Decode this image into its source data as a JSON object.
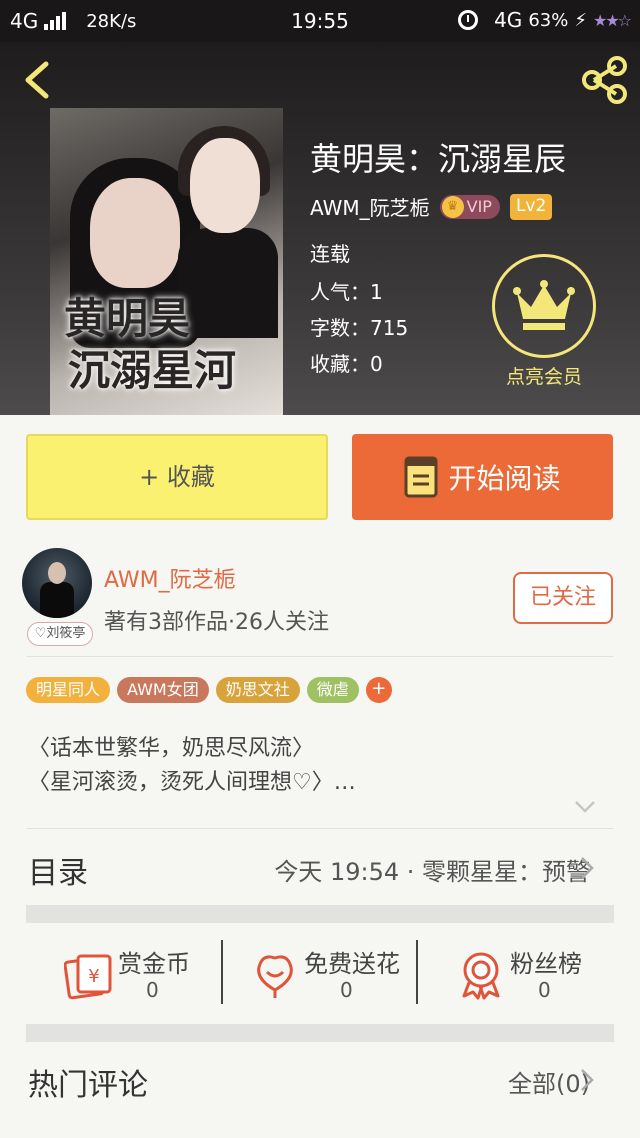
{
  "status_bar": {
    "network": "4G",
    "speed": "28K/s",
    "time": "19:55",
    "network_right": "4G",
    "battery": "63%"
  },
  "book": {
    "title": "黄明昊：沉溺星辰",
    "cover_title_line1": "黄明昊",
    "cover_title_line2": "沉溺星河",
    "author": "AWM_阮芝栀",
    "vip_label": "VIP",
    "level": "Lv2",
    "status": "连载",
    "popularity": "人气：1",
    "word_count": "字数：715",
    "favorites": "收藏：0"
  },
  "member": {
    "label": "点亮会员"
  },
  "actions": {
    "favorite_label": "+ 收藏",
    "read_label": "开始阅读"
  },
  "author_panel": {
    "name": "AWM_阮芝栀",
    "meta": "著有3部作品·26人关注",
    "avatar_tag": "♡刘筱亭",
    "follow_label": "已关注"
  },
  "tags": [
    {
      "label": "明星同人",
      "color": "#f2b13c"
    },
    {
      "label": "AWM女团",
      "color": "#c9785c"
    },
    {
      "label": "奶思文社",
      "color": "#d9a33c"
    },
    {
      "label": "微虐",
      "color": "#9fc162"
    }
  ],
  "tag_more": "+",
  "description": {
    "line1": "〈话本世繁华，奶思尽风流〉",
    "line2": "〈星河滚烫，烫死人间理想♡〉…"
  },
  "catalog": {
    "title": "目录",
    "latest": "今天 19:54 · 零颗星星：预警"
  },
  "stats": [
    {
      "label": "赏金币",
      "value": "0",
      "icon": "gold-coin-envelope-icon"
    },
    {
      "label": "免费送花",
      "value": "0",
      "icon": "flower-icon"
    },
    {
      "label": "粉丝榜",
      "value": "0",
      "icon": "medal-icon"
    }
  ],
  "comments": {
    "title": "热门评论",
    "all_label": "全部(0)"
  },
  "colors": {
    "accent": "#eb6a37",
    "favorite_bg": "#fbf170",
    "member_gold": "#f3e77a"
  }
}
